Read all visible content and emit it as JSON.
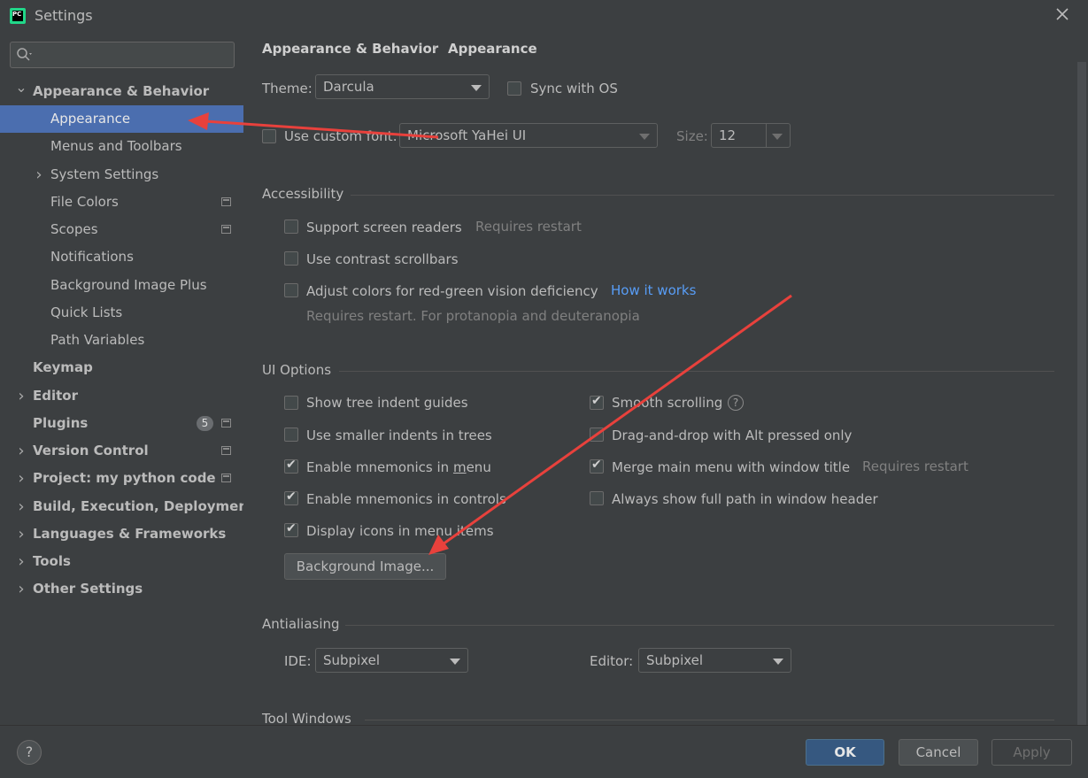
{
  "window": {
    "title": "Settings",
    "app_icon_text": "PC"
  },
  "sidebar": {
    "search_value": "",
    "items": [
      {
        "label": "Appearance & Behavior",
        "level": 0,
        "expanded": true,
        "bold": true
      },
      {
        "label": "Appearance",
        "level": 1,
        "selected": true
      },
      {
        "label": "Menus and Toolbars",
        "level": 1
      },
      {
        "label": "System Settings",
        "level": 1,
        "expandable": true
      },
      {
        "label": "File Colors",
        "level": 1,
        "project_icon": true
      },
      {
        "label": "Scopes",
        "level": 1,
        "project_icon": true
      },
      {
        "label": "Notifications",
        "level": 1
      },
      {
        "label": "Background Image Plus",
        "level": 1
      },
      {
        "label": "Quick Lists",
        "level": 1
      },
      {
        "label": "Path Variables",
        "level": 1
      },
      {
        "label": "Keymap",
        "level": 0,
        "bold": true
      },
      {
        "label": "Editor",
        "level": 0,
        "expandable": true,
        "bold": true
      },
      {
        "label": "Plugins",
        "level": 0,
        "bold": true,
        "badge": "5",
        "project_icon": true
      },
      {
        "label": "Version Control",
        "level": 0,
        "expandable": true,
        "bold": true,
        "project_icon": true
      },
      {
        "label": "Project: my python code",
        "level": 0,
        "expandable": true,
        "bold": true,
        "project_icon": true
      },
      {
        "label": "Build, Execution, Deployment",
        "level": 0,
        "expandable": true,
        "bold": true
      },
      {
        "label": "Languages & Frameworks",
        "level": 0,
        "expandable": true,
        "bold": true
      },
      {
        "label": "Tools",
        "level": 0,
        "expandable": true,
        "bold": true
      },
      {
        "label": "Other Settings",
        "level": 0,
        "expandable": true,
        "bold": true
      }
    ]
  },
  "breadcrumb": {
    "parent": "Appearance & Behavior",
    "separator": "›",
    "current": "Appearance"
  },
  "theme": {
    "label": "Theme:",
    "value": "Darcula",
    "sync_label": "Sync with OS",
    "sync_checked": false
  },
  "font": {
    "custom_label": "Use custom font:",
    "custom_checked": false,
    "value": "Microsoft YaHei UI",
    "size_label": "Size:",
    "size_value": "12"
  },
  "accessibility": {
    "title": "Accessibility",
    "screen_readers": {
      "label": "Support screen readers",
      "checked": false,
      "hint": "Requires restart"
    },
    "contrast_scrollbars": {
      "label": "Use contrast scrollbars",
      "checked": false
    },
    "red_green": {
      "label": "Adjust colors for red-green vision deficiency",
      "checked": false,
      "link": "How it works",
      "hint": "Requires restart. For protanopia and deuteranopia"
    }
  },
  "ui_options": {
    "title": "UI Options",
    "tree_indent": {
      "label": "Show tree indent guides",
      "checked": false
    },
    "smaller_indents": {
      "label": "Use smaller indents in trees",
      "checked": false
    },
    "mnemonics_menu": {
      "label_pre": "Enable mnemonics in ",
      "label_u": "m",
      "label_post": "enu",
      "checked": true
    },
    "mnemonics_controls": {
      "label": "Enable mnemonics in controls",
      "checked": true
    },
    "icons_menu": {
      "label": "Display icons in menu items",
      "checked": true
    },
    "smooth_scrolling": {
      "label": "Smooth scrolling",
      "checked": true,
      "help": "?"
    },
    "drag_drop_alt": {
      "label": "Drag-and-drop with Alt pressed only",
      "checked": false
    },
    "merge_menu": {
      "label": "Merge main menu with window title",
      "checked": true,
      "hint": "Requires restart"
    },
    "full_path": {
      "label": "Always show full path in window header",
      "checked": false
    },
    "bg_button": "Background Image..."
  },
  "antialiasing": {
    "title": "Antialiasing",
    "ide_label": "IDE:",
    "ide_value": "Subpixel",
    "editor_label": "Editor:",
    "editor_value": "Subpixel"
  },
  "tool_windows": {
    "title": "Tool Windows"
  },
  "footer": {
    "help": "?",
    "ok": "OK",
    "cancel": "Cancel",
    "apply": "Apply"
  },
  "colors": {
    "selection": "#4b6eaf",
    "background": "#3c3f41",
    "annotation_arrow": "#e8413c",
    "link": "#589df6"
  }
}
